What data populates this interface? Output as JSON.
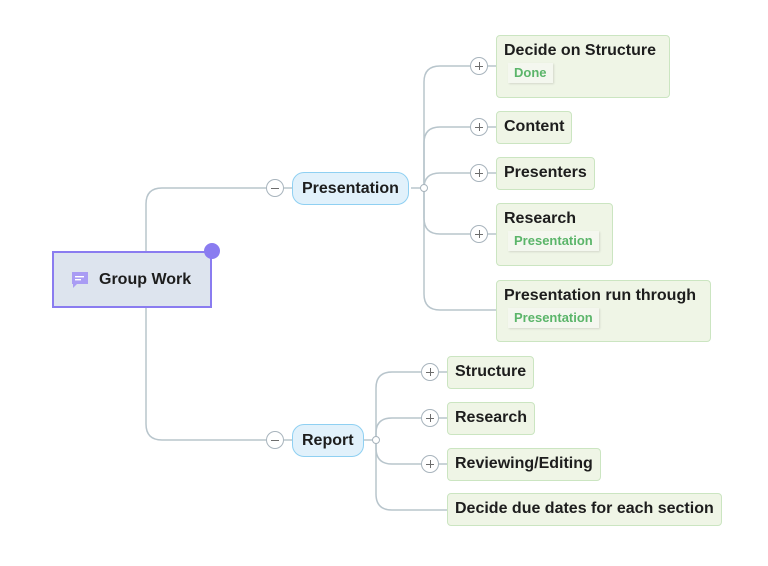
{
  "mindmap": {
    "central_topic": {
      "label": "Group Work",
      "icon": "comment-icon",
      "accent_color": "#8a7cf0"
    },
    "branches": [
      {
        "label": "Presentation",
        "collapse_toggle": "minus",
        "children": [
          {
            "label": "Decide on Structure",
            "tag": "Done",
            "expand_toggle": "plus"
          },
          {
            "label": "Content",
            "expand_toggle": "plus"
          },
          {
            "label": "Presenters",
            "expand_toggle": "plus"
          },
          {
            "label": "Research",
            "tag": "Presentation",
            "expand_toggle": "plus"
          },
          {
            "label": "Presentation run through",
            "tag": "Presentation"
          }
        ]
      },
      {
        "label": "Report",
        "collapse_toggle": "minus",
        "children": [
          {
            "label": "Structure",
            "expand_toggle": "plus"
          },
          {
            "label": "Research",
            "expand_toggle": "plus"
          },
          {
            "label": "Reviewing/Editing",
            "expand_toggle": "plus"
          },
          {
            "label": "Decide due dates for each section"
          }
        ]
      }
    ],
    "colors": {
      "central_fill": "#dde4ee",
      "main_topic_fill": "#e1f1fb",
      "main_topic_border": "#8fd0f2",
      "sub_topic_fill": "#eff5e6",
      "sub_topic_border": "#cbe5c1",
      "tag_text": "#5bb56a",
      "connector": "#b8c5cc"
    }
  }
}
